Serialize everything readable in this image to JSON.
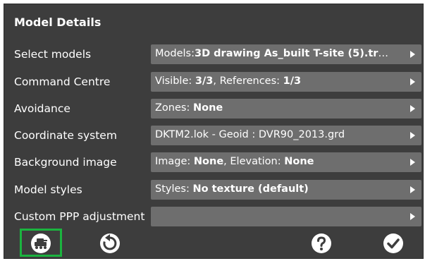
{
  "dialog": {
    "title": "Model Details"
  },
  "rows": [
    {
      "label": "Select models",
      "parts": [
        {
          "t": "Models:"
        },
        {
          "t": "3D drawing As_built T-site (5).trm…",
          "b": true
        }
      ]
    },
    {
      "label": "Command Centre",
      "parts": [
        {
          "t": "Visible: "
        },
        {
          "t": "3/3",
          "b": true
        },
        {
          "t": ", References: "
        },
        {
          "t": "1/3",
          "b": true
        }
      ]
    },
    {
      "label": "Avoidance",
      "parts": [
        {
          "t": "Zones: "
        },
        {
          "t": "None",
          "b": true
        }
      ]
    },
    {
      "label": "Coordinate system",
      "parts": [
        {
          "t": "DKTM2.lok - Geoid : DVR90_2013.grd"
        }
      ]
    },
    {
      "label": "Background image",
      "parts": [
        {
          "t": "Image: "
        },
        {
          "t": "None",
          "b": true
        },
        {
          "t": ", Elevation: "
        },
        {
          "t": "None",
          "b": true
        }
      ]
    },
    {
      "label": "Model styles",
      "parts": [
        {
          "t": "Styles: "
        },
        {
          "t": "No texture (default)",
          "b": true
        }
      ]
    },
    {
      "label": "Custom PPP adjustment",
      "parts": []
    }
  ],
  "toolbar": {
    "icons": [
      "machine-icon",
      "reset-icon",
      "help-icon",
      "confirm-icon"
    ],
    "highlight_color": "#1bb43f"
  },
  "colors": {
    "background": "#3d3d3d",
    "field": "#6e6e6e",
    "text": "#ffffff"
  }
}
